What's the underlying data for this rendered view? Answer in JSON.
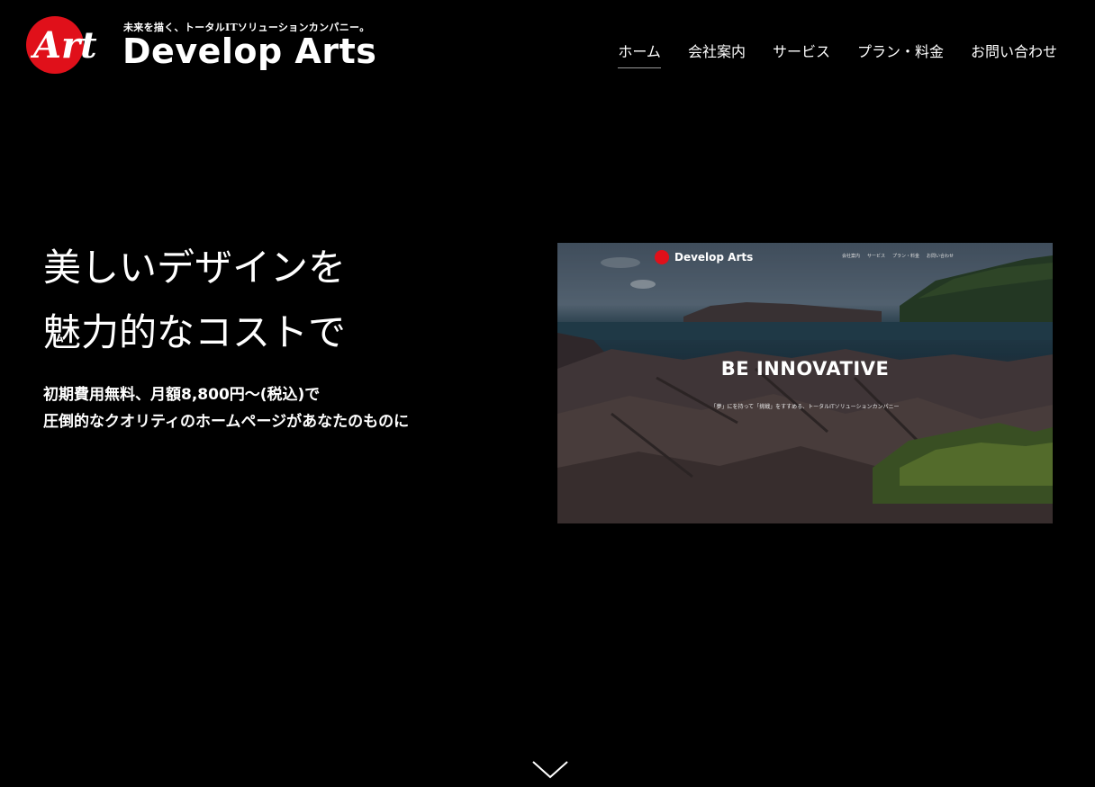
{
  "header": {
    "logo_mark": "Art",
    "tagline": "未来を描く、トータルITソリューションカンパニー。",
    "brand": "Develop Arts",
    "nav": [
      {
        "label": "ホーム",
        "active": true
      },
      {
        "label": "会社案内",
        "active": false
      },
      {
        "label": "サービス",
        "active": false
      },
      {
        "label": "プラン・料金",
        "active": false
      },
      {
        "label": "お問い合わせ",
        "active": false
      }
    ]
  },
  "hero": {
    "title_line1": "美しいデザインを",
    "title_line2": "魅力的なコストで",
    "sub_line1": "初期費用無料、月額8,800円〜(税込)で",
    "sub_line2": "圧倒的なクオリティのホームページがあなたのものに"
  },
  "preview": {
    "brand": "Develop Arts",
    "nav": [
      "会社案内",
      "サービス",
      "プラン・料金",
      "お問い合わせ"
    ],
    "headline": "BE INNOVATIVE",
    "subtext": "「夢」にを持って「挑戦」をすすめる、トータルITソリューションカンパニー"
  },
  "colors": {
    "background": "#000000",
    "accent_red": "#e0101a",
    "text": "#ffffff"
  },
  "icons": {
    "scroll": "chevron-down-icon"
  }
}
